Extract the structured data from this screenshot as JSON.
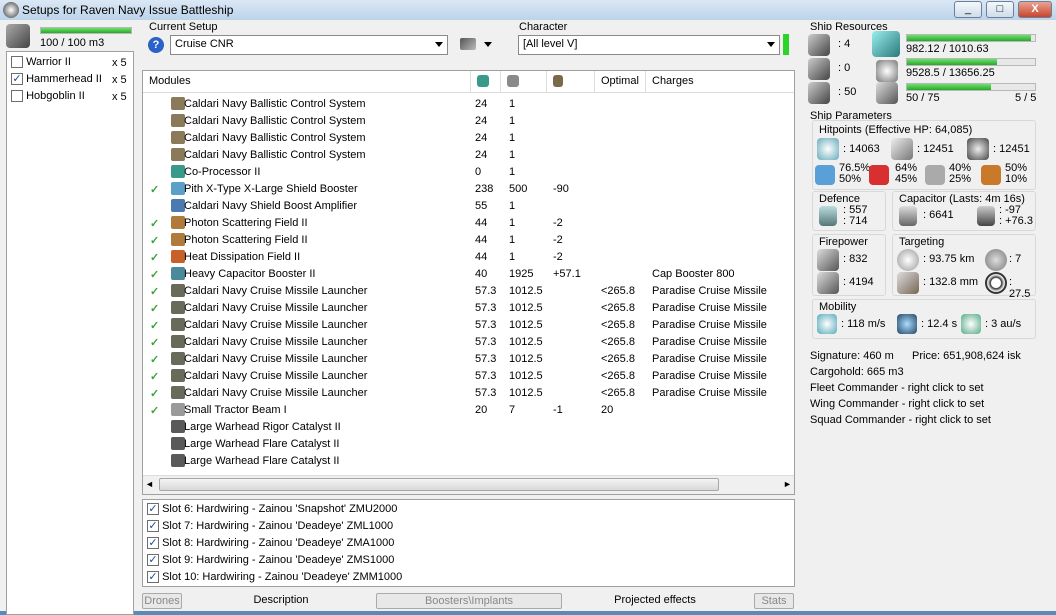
{
  "window": {
    "title": "Setups for Raven Navy Issue Battleship",
    "min": "_",
    "max": "□",
    "close": "X"
  },
  "drones_bay": {
    "capacity": "100 / 100 m3",
    "items": [
      {
        "name": "Warrior II",
        "qty": "x 5",
        "checked": false
      },
      {
        "name": "Hammerhead II",
        "qty": "x 5",
        "checked": true
      },
      {
        "name": "Hobgoblin II",
        "qty": "x 5",
        "checked": false
      }
    ]
  },
  "setup": {
    "label": "Current Setup",
    "value": "Cruise CNR",
    "help": "?"
  },
  "character": {
    "label": "Character",
    "value": "[All level V]"
  },
  "modules": {
    "headers": [
      "Modules",
      "",
      "",
      "",
      "Optimal",
      "Charges"
    ],
    "rows": [
      {
        "tick": "",
        "name": "Caldari Navy Ballistic Control System",
        "c1": "24",
        "c2": "1",
        "c3": "",
        "opt": "",
        "charge": "",
        "ic": "#8a7a5a"
      },
      {
        "tick": "",
        "name": "Caldari Navy Ballistic Control System",
        "c1": "24",
        "c2": "1",
        "c3": "",
        "opt": "",
        "charge": "",
        "ic": "#8a7a5a"
      },
      {
        "tick": "",
        "name": "Caldari Navy Ballistic Control System",
        "c1": "24",
        "c2": "1",
        "c3": "",
        "opt": "",
        "charge": "",
        "ic": "#8a7a5a"
      },
      {
        "tick": "",
        "name": "Caldari Navy Ballistic Control System",
        "c1": "24",
        "c2": "1",
        "c3": "",
        "opt": "",
        "charge": "",
        "ic": "#8a7a5a"
      },
      {
        "tick": "",
        "name": "Co-Processor II",
        "c1": "0",
        "c2": "1",
        "c3": "",
        "opt": "",
        "charge": "",
        "ic": "#3a9a8a"
      },
      {
        "tick": "✓",
        "name": "Pith X-Type X-Large Shield Booster",
        "c1": "238",
        "c2": "500",
        "c3": "-90",
        "opt": "",
        "charge": "",
        "ic": "#5aa0c8"
      },
      {
        "tick": "",
        "name": "Caldari Navy Shield Boost Amplifier",
        "c1": "55",
        "c2": "1",
        "c3": "",
        "opt": "",
        "charge": "",
        "ic": "#4a7ab0"
      },
      {
        "tick": "✓",
        "name": "Photon Scattering Field II",
        "c1": "44",
        "c2": "1",
        "c3": "-2",
        "opt": "",
        "charge": "",
        "ic": "#b07a3a"
      },
      {
        "tick": "✓",
        "name": "Photon Scattering Field II",
        "c1": "44",
        "c2": "1",
        "c3": "-2",
        "opt": "",
        "charge": "",
        "ic": "#b07a3a"
      },
      {
        "tick": "✓",
        "name": "Heat Dissipation Field II",
        "c1": "44",
        "c2": "1",
        "c3": "-2",
        "opt": "",
        "charge": "",
        "ic": "#c8602a"
      },
      {
        "tick": "✓",
        "name": "Heavy Capacitor Booster II",
        "c1": "40",
        "c2": "1925",
        "c3": "+57.1",
        "opt": "",
        "charge": "Cap Booster 800",
        "ic": "#4a8a9a"
      },
      {
        "tick": "✓",
        "name": "Caldari Navy Cruise Missile Launcher",
        "c1": "57.3",
        "c2": "1012.5",
        "c3": "",
        "opt": "<265.8",
        "charge": "Paradise Cruise Missile",
        "ic": "#6a6a5a"
      },
      {
        "tick": "✓",
        "name": "Caldari Navy Cruise Missile Launcher",
        "c1": "57.3",
        "c2": "1012.5",
        "c3": "",
        "opt": "<265.8",
        "charge": "Paradise Cruise Missile",
        "ic": "#6a6a5a"
      },
      {
        "tick": "✓",
        "name": "Caldari Navy Cruise Missile Launcher",
        "c1": "57.3",
        "c2": "1012.5",
        "c3": "",
        "opt": "<265.8",
        "charge": "Paradise Cruise Missile",
        "ic": "#6a6a5a"
      },
      {
        "tick": "✓",
        "name": "Caldari Navy Cruise Missile Launcher",
        "c1": "57.3",
        "c2": "1012.5",
        "c3": "",
        "opt": "<265.8",
        "charge": "Paradise Cruise Missile",
        "ic": "#6a6a5a"
      },
      {
        "tick": "✓",
        "name": "Caldari Navy Cruise Missile Launcher",
        "c1": "57.3",
        "c2": "1012.5",
        "c3": "",
        "opt": "<265.8",
        "charge": "Paradise Cruise Missile",
        "ic": "#6a6a5a"
      },
      {
        "tick": "✓",
        "name": "Caldari Navy Cruise Missile Launcher",
        "c1": "57.3",
        "c2": "1012.5",
        "c3": "",
        "opt": "<265.8",
        "charge": "Paradise Cruise Missile",
        "ic": "#6a6a5a"
      },
      {
        "tick": "✓",
        "name": "Caldari Navy Cruise Missile Launcher",
        "c1": "57.3",
        "c2": "1012.5",
        "c3": "",
        "opt": "<265.8",
        "charge": "Paradise Cruise Missile",
        "ic": "#6a6a5a"
      },
      {
        "tick": "✓",
        "name": "Small Tractor Beam I",
        "c1": "20",
        "c2": "7",
        "c3": "-1",
        "opt": "20",
        "charge": "",
        "ic": "#9a9a9a"
      },
      {
        "tick": "",
        "name": "Large Warhead Rigor Catalyst II",
        "c1": "",
        "c2": "",
        "c3": "",
        "opt": "",
        "charge": "",
        "ic": "#5a5a5a"
      },
      {
        "tick": "",
        "name": "Large Warhead Flare Catalyst II",
        "c1": "",
        "c2": "",
        "c3": "",
        "opt": "",
        "charge": "",
        "ic": "#5a5a5a"
      },
      {
        "tick": "",
        "name": "Large Warhead Flare Catalyst II",
        "c1": "",
        "c2": "",
        "c3": "",
        "opt": "",
        "charge": "",
        "ic": "#5a5a5a"
      }
    ]
  },
  "implants": [
    "Slot 6: Hardwiring - Zainou 'Snapshot' ZMU2000",
    "Slot 7: Hardwiring - Zainou 'Deadeye' ZML1000",
    "Slot 8: Hardwiring - Zainou 'Deadeye' ZMA1000",
    "Slot 9: Hardwiring - Zainou 'Deadeye' ZMS1000",
    "Slot 10: Hardwiring - Zainou 'Deadeye' ZMM1000"
  ],
  "tabs": [
    "Drones",
    "Description",
    "Boosters\\Implants",
    "Projected effects",
    "Stats"
  ],
  "resources": {
    "title": "Ship Resources",
    "hardpoints_turret": ": 4",
    "hardpoints_launcher": ": 0",
    "calibration": ": 50",
    "cpu": "982.12 / 1010.63",
    "cpu_frac": 0.97,
    "power": "9528.5 / 13656.25",
    "power_frac": 0.7,
    "drone_bw": "50 / 75",
    "drone_bw_frac": 0.66,
    "drones_active": "5 / 5"
  },
  "params": {
    "title": "Ship Parameters",
    "hp_title": "Hitpoints (Effective HP: 64,085)",
    "shield_hp": ": 14063",
    "armor_hp": ": 12451",
    "structure_hp": ": 12451",
    "res": [
      [
        "76.5%",
        "50%"
      ],
      [
        "64%",
        "45%"
      ],
      [
        "40%",
        "25%"
      ],
      [
        "50%",
        "10%"
      ]
    ],
    "defence_title": "Defence",
    "def1": ": 557",
    "def2": ": 714",
    "cap_title": "Capacitor (Lasts: 4m 16s)",
    "cap_amount": ": 6641",
    "cap1": ": -97",
    "cap2": ": +76.3",
    "fp_title": "Firepower",
    "fp1": ": 832",
    "fp2": ": 4194",
    "tg_title": "Targeting",
    "range": ": 93.75 km",
    "targets": ": 7",
    "scanres": ": 132.8 mm",
    "sensor": ": 27.5",
    "mob_title": "Mobility",
    "speed": ": 118 m/s",
    "align": ": 12.4 s",
    "warp": ": 3 au/s",
    "signature": "Signature: 460 m",
    "price": "Price: 651,908,624 isk",
    "cargo": "Cargohold: 665 m3",
    "fleet": "Fleet Commander - right click to set",
    "wing": "Wing Commander - right click to set",
    "squad": "Squad Commander - right click to set"
  }
}
